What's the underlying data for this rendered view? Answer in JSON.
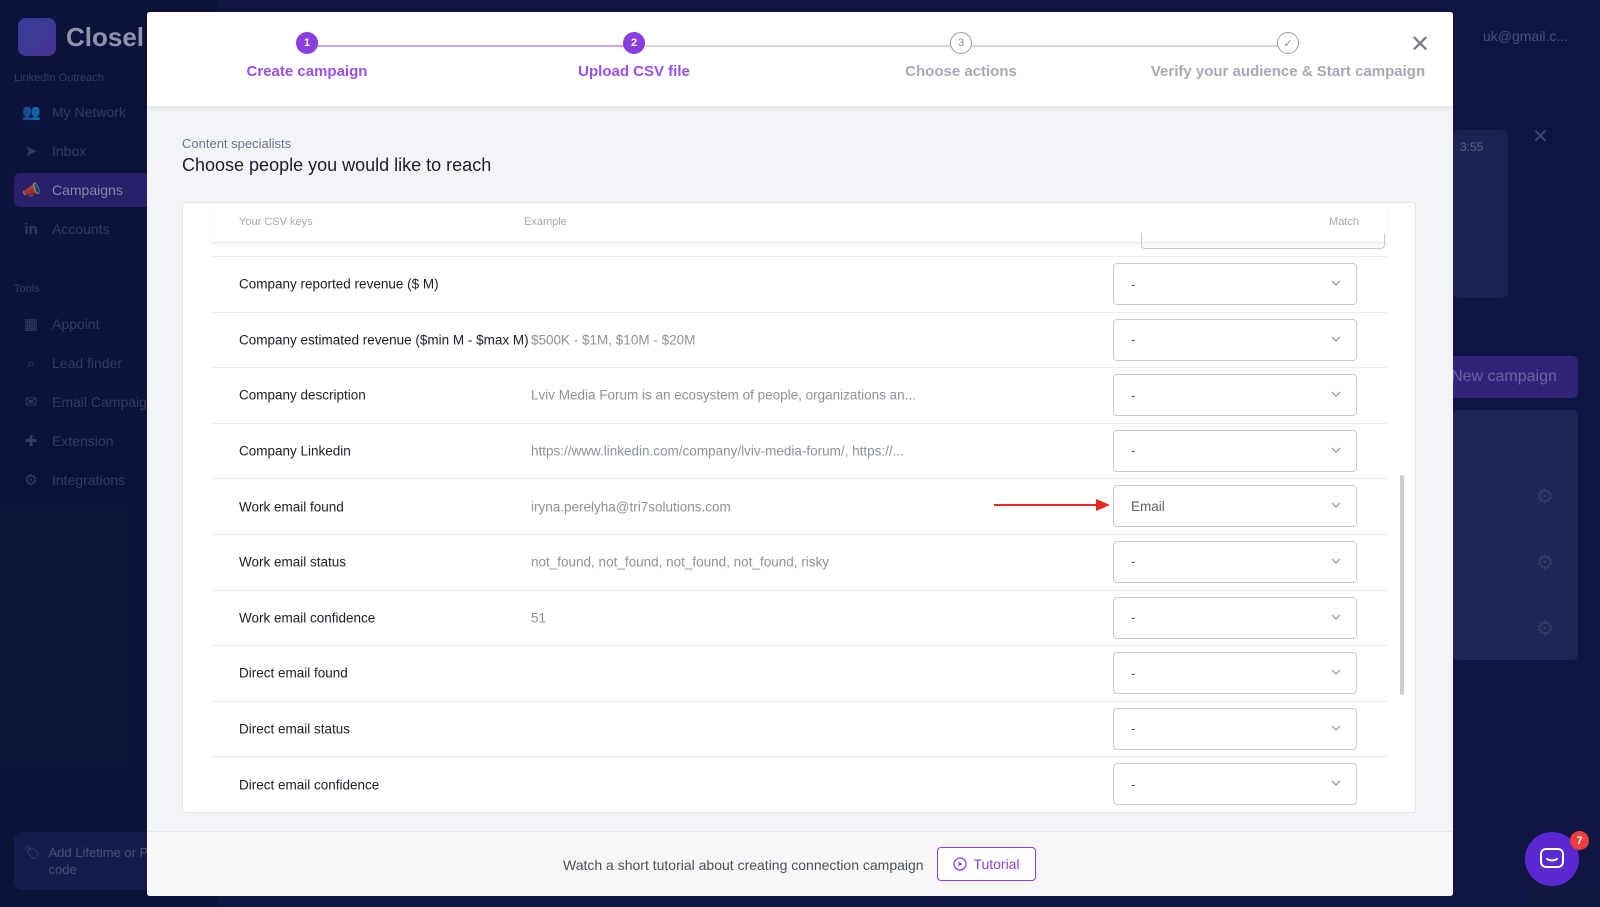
{
  "background": {
    "logo_text": "Closel",
    "section_outreach": "LinkedIn Outreach",
    "section_tools": "Tools",
    "nav": [
      {
        "label": "My Network",
        "icon": "people-icon"
      },
      {
        "label": "Inbox",
        "icon": "send-icon"
      },
      {
        "label": "Campaigns",
        "icon": "megaphone-icon"
      },
      {
        "label": "Accounts",
        "icon": "linkedin-icon"
      }
    ],
    "tools": [
      {
        "label": "Appoint",
        "icon": "calendar-icon"
      },
      {
        "label": "Lead finder",
        "icon": "search-icon"
      },
      {
        "label": "Email Campaig",
        "icon": "envelope-icon"
      },
      {
        "label": "Extension",
        "icon": "puzzle-icon"
      },
      {
        "label": "Integrations",
        "icon": "integrations-icon"
      }
    ],
    "promo_text": "Add Lifetime or Promo code",
    "account_email": "uk@gmail.c...",
    "timer": "3:55",
    "new_campaign_label": "New campaign"
  },
  "stepper": {
    "steps": [
      {
        "number": "1",
        "label": "Create campaign",
        "state": "done"
      },
      {
        "number": "2",
        "label": "Upload CSV file",
        "state": "done"
      },
      {
        "number": "3",
        "label": "Choose actions",
        "state": "todo"
      },
      {
        "number": "✓",
        "label": "Verify your audience & Start campaign",
        "state": "todo"
      }
    ],
    "active_color": "#8a3ee0"
  },
  "content": {
    "subtitle": "Content specialists",
    "title": "Choose people you would like to reach"
  },
  "table": {
    "headers": {
      "keys": "Your CSV keys",
      "example": "Example",
      "match": "Match"
    },
    "rows": [
      {
        "key": "Company reported revenue ($ M)",
        "example": "",
        "match": "-"
      },
      {
        "key": "Company estimated revenue ($min M - $max M)",
        "example": "$500K - $1M, $10M - $20M",
        "match": "-"
      },
      {
        "key": "Company description",
        "example": "Lviv Media Forum is an ecosystem of people, organizations an...",
        "match": "-"
      },
      {
        "key": "Company Linkedin",
        "example": "https://www.linkedin.com/company/lviv-media-forum/, https://...",
        "match": "-"
      },
      {
        "key": "Work email found",
        "example": "iryna.perelyha@tri7solutions.com",
        "match": "Email",
        "highlighted": true
      },
      {
        "key": "Work email status",
        "example": "not_found, not_found, not_found, not_found, risky",
        "match": "-"
      },
      {
        "key": "Work email confidence",
        "example": "51",
        "match": "-"
      },
      {
        "key": "Direct email found",
        "example": "",
        "match": "-"
      },
      {
        "key": "Direct email status",
        "example": "",
        "match": "-"
      },
      {
        "key": "Direct email confidence",
        "example": "",
        "match": "-"
      }
    ]
  },
  "footer": {
    "text": "Watch a short tutorial about creating connection campaign",
    "tutorial_label": "Tutorial"
  },
  "chat": {
    "badge_count": "7"
  },
  "colors": {
    "accent": "#8a3ee0",
    "arrow": "#e02a1f",
    "badge": "#ef3d3d"
  }
}
